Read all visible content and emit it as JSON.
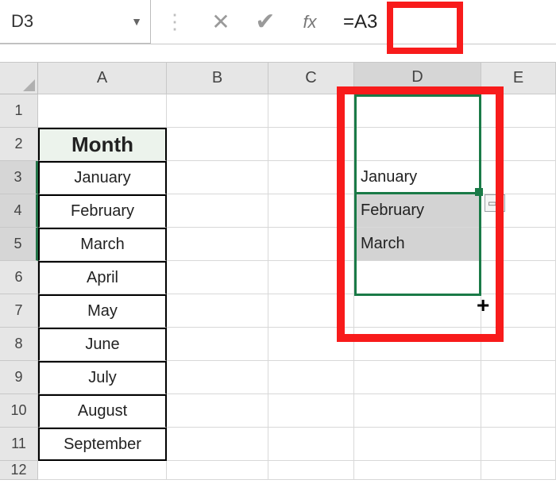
{
  "namebox": {
    "value": "D3"
  },
  "formula": {
    "value": "=A3"
  },
  "columns": [
    "A",
    "B",
    "C",
    "D",
    "E"
  ],
  "rows": [
    1,
    2,
    3,
    4,
    5,
    6,
    7,
    8,
    9,
    10,
    11,
    12
  ],
  "header_label": "Month",
  "months": {
    "r3": "January",
    "r4": "February",
    "r5": "March",
    "r6": "April",
    "r7": "May",
    "r8": "June",
    "r9": "July",
    "r10": "August",
    "r11": "September"
  },
  "colD": {
    "r3": "January",
    "r4": "February",
    "r5": "March"
  },
  "icons": {
    "dropdown": "▼",
    "dots": "⋮",
    "cancel": "✕",
    "confirm": "✔",
    "fx": "fx",
    "autofill": "▭₊",
    "plus": "+"
  }
}
